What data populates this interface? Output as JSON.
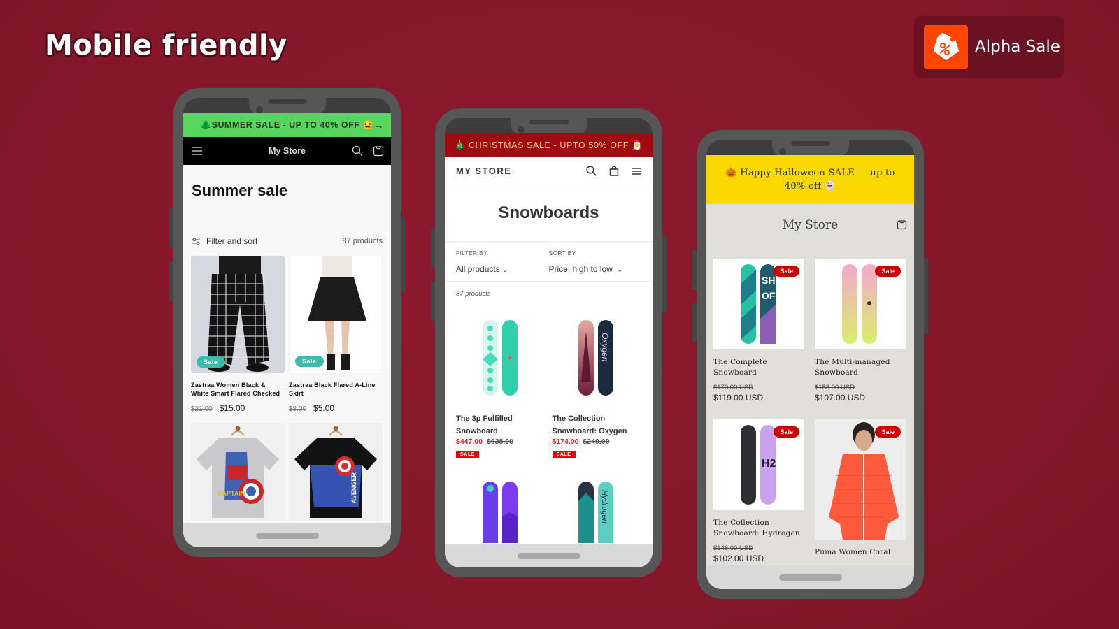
{
  "headline": "Mobile friendly",
  "brand": {
    "name": "Alpha Sale",
    "logo_icon": "percent-tag-icon",
    "logo_color": "#ff4500"
  },
  "colors": {
    "background": "#86172b",
    "phone_frame": "#565656"
  },
  "phones": [
    {
      "announcement": "🌲SUMMER SALE - UP TO 40% OFF 😆",
      "announcement_arrow": "→",
      "announcement_bg": "#57d55c",
      "store_name": "My Store",
      "page_title": "Summer sale",
      "filter_label": "Filter and sort",
      "product_count": "87 products",
      "products": [
        {
          "name": "Zastraa Women Black & White Smart Flared Checked",
          "compare_price": "$21.00",
          "price": "$15.00",
          "badge": "Sale"
        },
        {
          "name": "Zastraa Black Flared A-Line Skirt",
          "compare_price": "$8.00",
          "price": "$5.00",
          "badge": "Sale"
        },
        {
          "name": "Captain America grey t-shirt",
          "image_only": true
        },
        {
          "name": "Avengers black t-shirt",
          "image_only": true
        }
      ]
    },
    {
      "announcement": "🎄 CHRISTMAS SALE - UPTO 50% OFF 🎅",
      "announcement_bg": "#a00b12",
      "store_name": "MY STORE",
      "page_title": "Snowboards",
      "filter_label": "FILTER BY",
      "filter_value": "All products",
      "sort_label": "SORT BY",
      "sort_value": "Price, high to low",
      "product_count": "87 products",
      "products": [
        {
          "name": "The 3p Fulfilled Snowboard",
          "price": "$447.00",
          "compare_price": "$638.00",
          "badge": "SALE"
        },
        {
          "name": "The Collection Snowboard: Oxygen",
          "price": "$174.00",
          "compare_price": "$249.00",
          "badge": "SALE"
        }
      ]
    },
    {
      "announcement": "🎃 Happy Halloween SALE — up to 40% off 👻",
      "announcement_bg": "#fad800",
      "store_name": "My Store",
      "products": [
        {
          "name": "The Complete Snowboard",
          "compare_price": "$170.00 USD",
          "price": "$119.00 USD",
          "badge": "Sale"
        },
        {
          "name": "The Multi-managed Snowboard",
          "compare_price": "$153.00 USD",
          "price": "$107.00 USD",
          "badge": "Sale"
        },
        {
          "name": "The Collection Snowboard: Hydrogen",
          "compare_price": "$146.00 USD",
          "price": "$102.00 USD",
          "badge": "Sale"
        },
        {
          "name": "Puma Women Coral",
          "badge": "Sale"
        }
      ]
    }
  ]
}
